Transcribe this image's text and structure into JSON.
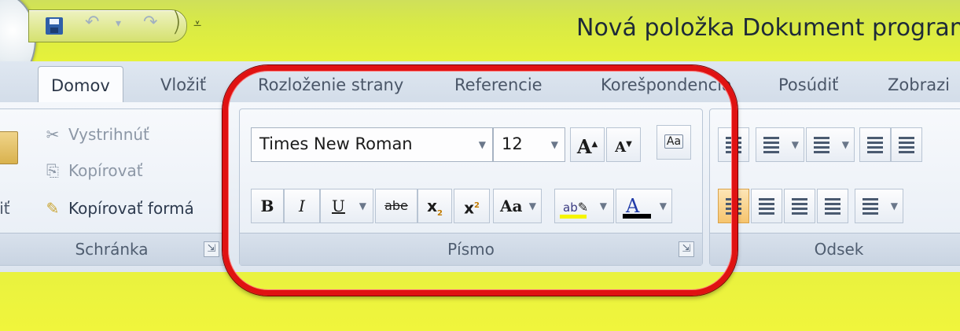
{
  "window": {
    "title": "Nová položka Dokument programu M"
  },
  "quick_access": {
    "save_icon": "save-icon",
    "undo_icon": "↶",
    "dropdown_icon": "▾",
    "redo_icon": "↷",
    "customize_icon": "₹"
  },
  "tabs": [
    {
      "label": "Domov",
      "active": true
    },
    {
      "label": "Vložiť"
    },
    {
      "label": "Rozloženie strany"
    },
    {
      "label": "Referencie"
    },
    {
      "label": "Korešpondencia"
    },
    {
      "label": "Posúdiť"
    },
    {
      "label": "Zobrazi"
    }
  ],
  "clipboard": {
    "paste_label": "oiť",
    "cut_label": "Vystrihnúť",
    "copy_label": "Kopírovať",
    "format_painter_label": "Kopírovať formá",
    "group_label": "Schránka"
  },
  "font": {
    "font_name": "Times New Roman",
    "font_size": "12",
    "grow_label": "A",
    "shrink_label": "A",
    "clear_format_label": "Aa",
    "bold_label": "B",
    "italic_label": "I",
    "underline_label": "U",
    "strike_label": "abe",
    "subscript_label": "x",
    "superscript_label": "x",
    "change_case_label": "Aa",
    "highlight_label": "ab",
    "font_color_label": "A",
    "highlight_color": "#f5f500",
    "font_color": "#000000",
    "group_label": "Písmo",
    "launcher_icon": "⇲"
  },
  "paragraph": {
    "group_label": "Odsek"
  },
  "highlight_color": "#e01212"
}
